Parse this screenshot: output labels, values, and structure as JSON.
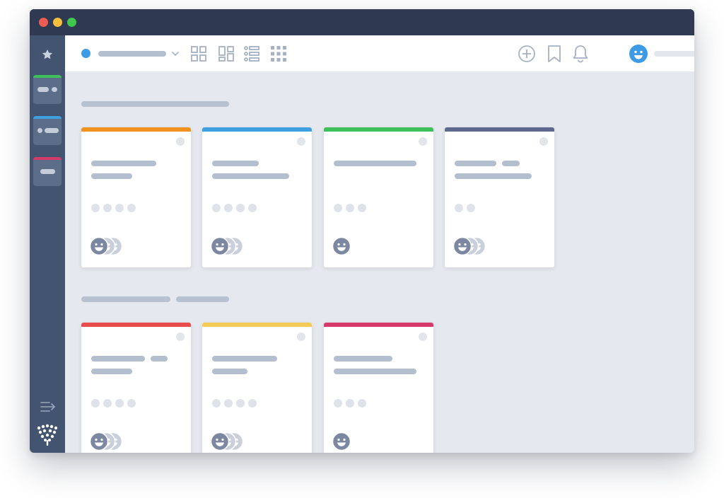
{
  "window": {
    "controls": [
      "close",
      "minimize",
      "zoom"
    ],
    "colors": {
      "close": "#ed5b55",
      "minimize": "#f6bf3c",
      "zoom": "#3ec84c",
      "titlebar": "#2f3a52",
      "sidebar": "#425470",
      "content_bg": "#e5e8ee"
    }
  },
  "sidebar": {
    "top_icon": "star-icon",
    "workspaces": [
      {
        "name": "workspace-1",
        "color": "#3ec05a"
      },
      {
        "name": "workspace-2",
        "color": "#3ea0e0"
      },
      {
        "name": "workspace-3",
        "color": "#d63a6b"
      }
    ],
    "bottom_icons": [
      "collapse-sidebar-icon",
      "tree-logo-icon"
    ]
  },
  "toolbar": {
    "status_color": "#3e9be6",
    "title_text": "",
    "view_icons": [
      "grid-view-icon",
      "masonry-view-icon",
      "list-view-icon",
      "compact-grid-view-icon"
    ],
    "right_icons": [
      "add-icon",
      "bookmark-icon",
      "bell-icon"
    ],
    "avatar_color": "#3e9be6",
    "user_name": ""
  },
  "sections": [
    {
      "title": "",
      "cards": [
        {
          "strip_color": "#f2921e",
          "tags": 4,
          "members": 3
        },
        {
          "strip_color": "#3ea0e0",
          "tags": 4,
          "members": 3
        },
        {
          "strip_color": "#3ec05a",
          "tags": 3,
          "members": 1
        },
        {
          "strip_color": "#5d6a8d",
          "tags": 2,
          "members": 3
        }
      ]
    },
    {
      "title": "",
      "cards": [
        {
          "strip_color": "#ea4b4b",
          "tags": 4,
          "members": 3
        },
        {
          "strip_color": "#f5cb58",
          "tags": 4,
          "members": 3
        },
        {
          "strip_color": "#d63a6b",
          "tags": 3,
          "members": 1
        }
      ]
    }
  ]
}
